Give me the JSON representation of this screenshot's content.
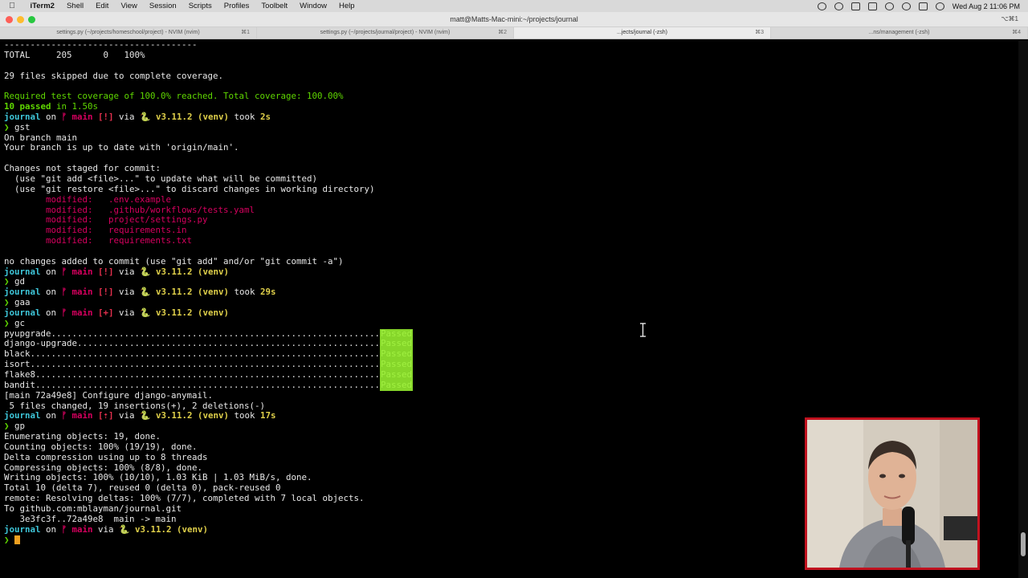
{
  "menubar": {
    "app": "iTerm2",
    "items": [
      "Shell",
      "Edit",
      "View",
      "Session",
      "Scripts",
      "Profiles",
      "Toolbelt",
      "Window",
      "Help"
    ],
    "clock": "Wed Aug 2  11:06 PM"
  },
  "window": {
    "title": "matt@Matts-Mac-mini:~/projects/journal",
    "shortcut": "⌥⌘1"
  },
  "tabs": [
    {
      "label": "settings.py (~/projects/homeschool/project) - NVIM (nvim)",
      "kbd": "⌘1"
    },
    {
      "label": "settings.py (~/projects/journal/project) - NVIM (nvim)",
      "kbd": "⌘2"
    },
    {
      "label": "...jects/journal (-zsh)",
      "kbd": "⌘3"
    },
    {
      "label": "...ns/management (-zsh)",
      "kbd": "⌘4"
    }
  ],
  "terminal": {
    "l01": "-------------------------------------",
    "l02": "TOTAL     205      0   100%",
    "l04": "29 files skipped due to complete coverage.",
    "l06": "Required test coverage of 100.0% reached. Total coverage: 100.00%",
    "l07a": "10 passed",
    "l07b": " in 1.50s",
    "prompt_dir": "journal",
    "on": " on ",
    "branch_main": "ᚠ main",
    "status_bang": " [!]",
    "status_plus": " [+]",
    "status_up": " [⇡]",
    "via": " via ",
    "snake": "🐍 ",
    "py": "v3.11.2",
    "venv": " (venv)",
    "took": " took ",
    "took_2s": "2s",
    "took_29s": "29s",
    "took_17s": "17s",
    "chev": "❯ ",
    "cmd_gst": "gst",
    "l10": "On branch main",
    "l11": "Your branch is up to date with 'origin/main'.",
    "l13": "Changes not staged for commit:",
    "l14": "  (use \"git add <file>...\" to update what will be committed)",
    "l15": "  (use \"git restore <file>...\" to discard changes in working directory)",
    "mod_label": "        modified:   ",
    "mod1": ".env.example",
    "mod2": ".github/workflows/tests.yaml",
    "mod3": "project/settings.py",
    "mod4": "requirements.in",
    "mod5": "requirements.txt",
    "l22": "no changes added to commit (use \"git add\" and/or \"git commit -a\")",
    "cmd_gd": "gd",
    "cmd_gaa": "gaa",
    "cmd_gc": "gc",
    "hook1": "pyupgrade...............................................................",
    "hook2": "django-upgrade..........................................................",
    "hook3": "black...................................................................",
    "hook4": "isort...................................................................",
    "hook5": "flake8..................................................................",
    "hook6": "bandit..................................................................",
    "passed": "Passed",
    "commit1": "[main 72a49e8] Configure django-anymail.",
    "commit2": " 5 files changed, 19 insertions(+), 2 deletions(-)",
    "cmd_gp": "gp",
    "push1": "Enumerating objects: 19, done.",
    "push2": "Counting objects: 100% (19/19), done.",
    "push3": "Delta compression using up to 8 threads",
    "push4": "Compressing objects: 100% (8/8), done.",
    "push5": "Writing objects: 100% (10/10), 1.03 KiB | 1.03 MiB/s, done.",
    "push6": "Total 10 (delta 7), reused 0 (delta 0), pack-reused 0",
    "push7": "remote: Resolving deltas: 100% (7/7), completed with 7 local objects.",
    "push8": "To github.com:mblayman/journal.git",
    "push9": "   3e3fc3f..72a49e8  main -> main"
  },
  "colors": {
    "menubar": "#d9d9d9",
    "terminal_bg": "#000000",
    "prompt_dir": "#3ec6d9",
    "branch": "#d7005f",
    "python": "#e0d04a",
    "passed_bg": "#86d62a",
    "webcam_border": "#c1121f"
  }
}
